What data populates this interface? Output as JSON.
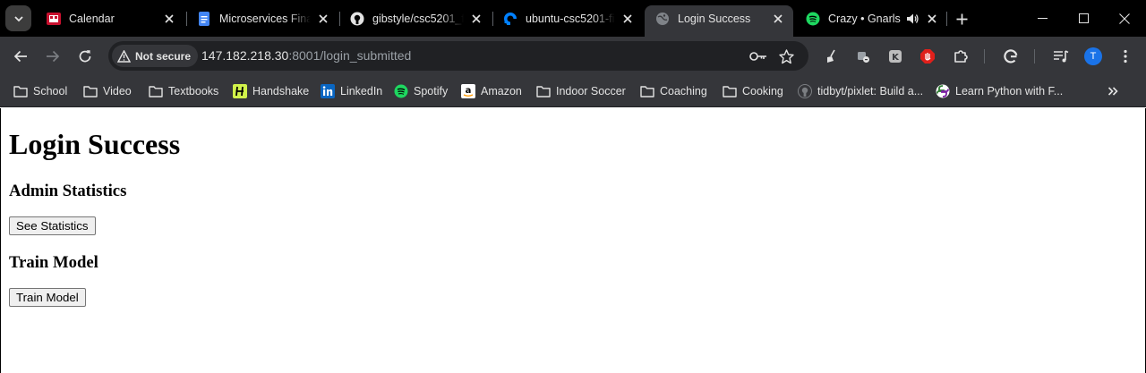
{
  "tabs": [
    {
      "title": "Calendar",
      "icon": "calendar-favicon"
    },
    {
      "title": "Microservices Final",
      "icon": "docs-favicon"
    },
    {
      "title": "gibstyle/csc5201_fi",
      "icon": "github-favicon"
    },
    {
      "title": "ubuntu-csc5201-fi",
      "icon": "digitalocean-favicon"
    },
    {
      "title": "Login Success",
      "icon": "globe-favicon",
      "active": true
    },
    {
      "title": "Crazy • Gnarls",
      "icon": "spotify-favicon",
      "audio": true
    }
  ],
  "omnibox": {
    "security_label": "Not secure",
    "url_host": "147.182.218.30",
    "url_rest": ":8001/login_submitted"
  },
  "profile": {
    "initial": "T"
  },
  "bookmarks": [
    {
      "label": "School",
      "icon": "folder-icon"
    },
    {
      "label": "Video",
      "icon": "folder-icon"
    },
    {
      "label": "Textbooks",
      "icon": "folder-icon"
    },
    {
      "label": "Handshake",
      "icon": "handshake-icon"
    },
    {
      "label": "LinkedIn",
      "icon": "linkedin-icon"
    },
    {
      "label": "Spotify",
      "icon": "spotify-icon"
    },
    {
      "label": "Amazon",
      "icon": "amazon-icon"
    },
    {
      "label": "Indoor Soccer",
      "icon": "folder-icon"
    },
    {
      "label": "Coaching",
      "icon": "folder-icon"
    },
    {
      "label": "Cooking",
      "icon": "folder-icon"
    },
    {
      "label": "tidbyt/pixlet: Build a...",
      "icon": "github-icon"
    },
    {
      "label": "Learn Python with F...",
      "icon": "python-icon"
    }
  ],
  "page": {
    "title": "Login Success",
    "admin_heading": "Admin Statistics",
    "stats_button": "See Statistics",
    "train_heading": "Train Model",
    "train_button": "Train Model"
  },
  "colors": {
    "tabstrip_bg": "#000000",
    "toolbar_bg": "#35363a",
    "omnibox_bg": "#202124",
    "spotify_green": "#1ed760",
    "profile_blue": "#1a73e8"
  }
}
